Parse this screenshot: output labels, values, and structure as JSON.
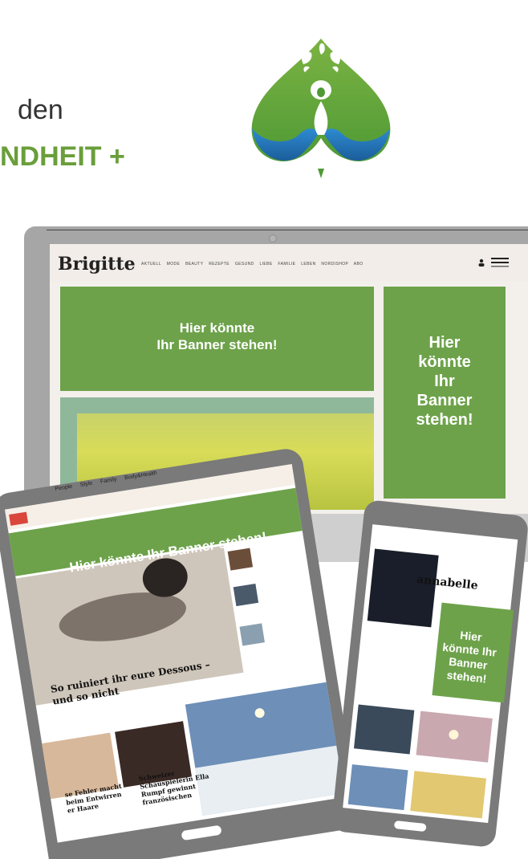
{
  "header": {
    "line1": "den",
    "line2": "NDHEIT +"
  },
  "logo": {
    "icon": "health-tree-logo",
    "colors": {
      "green": "#6aa636",
      "blue": "#2a6fb0"
    }
  },
  "desktop": {
    "site_name": "Brigitte",
    "nav": [
      "AKTUELL",
      "MODE",
      "BEAUTY",
      "REZEPTE",
      "GESUND",
      "LIEBE",
      "FAMILIE",
      "LEBEN",
      "NORDISHOP",
      "ABO"
    ],
    "banner_wide": "Hier könnte Ihr Banner stehen!",
    "banner_wide_lines": [
      "Hier könnte",
      "Ihr Banner stehen!"
    ],
    "banner_tall_lines": [
      "Hier",
      "könnte",
      "Ihr",
      "Banner",
      "stehen!"
    ]
  },
  "tablet": {
    "nav": [
      "People",
      "Style",
      "Family",
      "Body&Health"
    ],
    "banner": "Hier könnte Ihr Banner stehen!",
    "headline_lines": [
      "So ruiniert ihr eure Dessous –",
      "und so nicht"
    ],
    "card1_lines": [
      "se Fehler macht",
      "beim Entwirren",
      "er Haare"
    ],
    "card2_lines": [
      "Schweizer",
      "Schauspielerin Ella",
      "Rumpf gewinnt",
      "französischen"
    ]
  },
  "phone": {
    "site_name": "annabelle",
    "banner_lines": [
      "Hier",
      "könnte Ihr",
      "Banner",
      "stehen!"
    ]
  },
  "colors": {
    "banner_green": "#6da24a",
    "heading_green": "#6a9e3a",
    "device_gray": "#7c7c7c"
  }
}
